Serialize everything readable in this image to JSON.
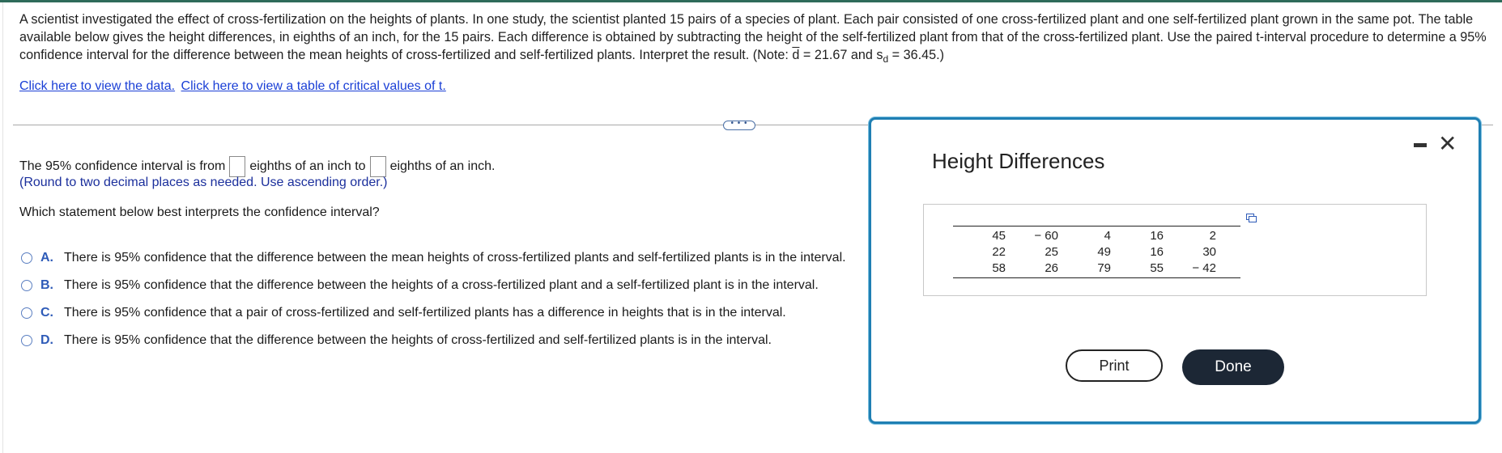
{
  "question": {
    "text_main": "A scientist investigated the effect of cross-fertilization on the heights of plants. In one study, the scientist planted 15 pairs of a species of plant. Each pair consisted of one cross-fertilized plant and one self-fertilized plant grown in the same pot. The table available below gives the height differences, in eighths of an inch, for the 15 pairs. Each difference is obtained by subtracting the height of the self-fertilized plant from that of the cross-fertilized plant. Use the paired t-interval procedure to determine a 95% confidence interval for the difference between the mean heights of cross-fertilized and self-fertilized plants. Interpret the result. (Note: ",
    "dbar": "d",
    "dbar_value": " = 21.67 and s",
    "sd_sub": "d",
    "sd_value": " = 36.45.)"
  },
  "links": {
    "view_data": "Click here to view the data.",
    "view_table": "Click here to view a table of critical values of t."
  },
  "divider": {
    "expand_label": "• • •"
  },
  "answer": {
    "prefix": "The 95% confidence interval is from",
    "middle": "eighths of an inch to",
    "suffix": "eighths of an inch.",
    "note": "(Round to two decimal places as needed. Use ascending order.)"
  },
  "interpret_question": "Which statement below best interprets the confidence interval?",
  "options": [
    {
      "letter": "A.",
      "text": "There is 95% confidence that the difference between the mean heights of cross-fertilized plants and self-fertilized plants is in the interval."
    },
    {
      "letter": "B.",
      "text": "There is 95% confidence that the difference between the heights of a cross-fertilized plant and a self-fertilized plant is in the interval."
    },
    {
      "letter": "C.",
      "text": "There is 95% confidence that a pair of cross-fertilized and self-fertilized plants has a difference in heights that is in the interval."
    },
    {
      "letter": "D.",
      "text": "There is 95% confidence that the difference between the heights of cross-fertilized and self-fertilized plants is in the interval."
    }
  ],
  "dialog": {
    "title": "Height Differences",
    "table": [
      [
        "45",
        "− 60",
        "4",
        "16",
        "2"
      ],
      [
        "22",
        "25",
        "49",
        "16",
        "30"
      ],
      [
        "58",
        "26",
        "79",
        "55",
        "− 42"
      ]
    ],
    "print_label": "Print",
    "done_label": "Done",
    "close_glyph": "✕",
    "icons": [
      "minimize-icon",
      "close-icon",
      "copy-icon"
    ]
  },
  "colors": {
    "link": "#1a3fd6",
    "note": "#1b2f9c",
    "dialog_border": "#1f7fb3",
    "done_button": "#1c2735",
    "top_bar": "#2e6b5a"
  }
}
